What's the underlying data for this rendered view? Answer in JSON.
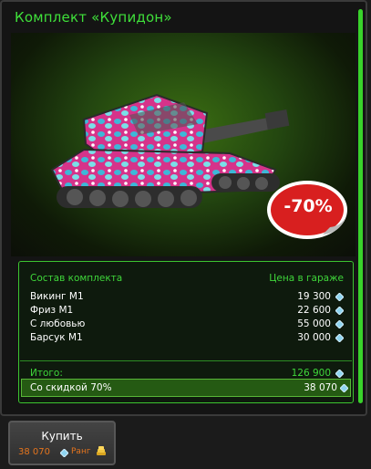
{
  "window": {
    "title": "Комплект «Купидон»"
  },
  "discount_badge": "-70%",
  "panel": {
    "header_left": "Состав комплекта",
    "header_right": "Цена в гараже",
    "items": [
      {
        "name": "Викинг М1",
        "price": "19 300"
      },
      {
        "name": "Фриз М1",
        "price": "22 600"
      },
      {
        "name": "С любовью",
        "price": "55 000"
      },
      {
        "name": "Барсук М1",
        "price": "30 000"
      }
    ],
    "total_label": "Итого:",
    "total_price": "126 900",
    "discount_label": "Со скидкой 70%",
    "discount_price": "38 070"
  },
  "buy": {
    "label": "Купить",
    "price": "38 070",
    "rank_label": "Ранг"
  },
  "colors": {
    "accent_green": "#3fe03a",
    "badge_red": "#d81f1f",
    "price_orange": "#e4741d"
  },
  "icons": [
    "crystal-icon",
    "rank-coin-icon"
  ]
}
